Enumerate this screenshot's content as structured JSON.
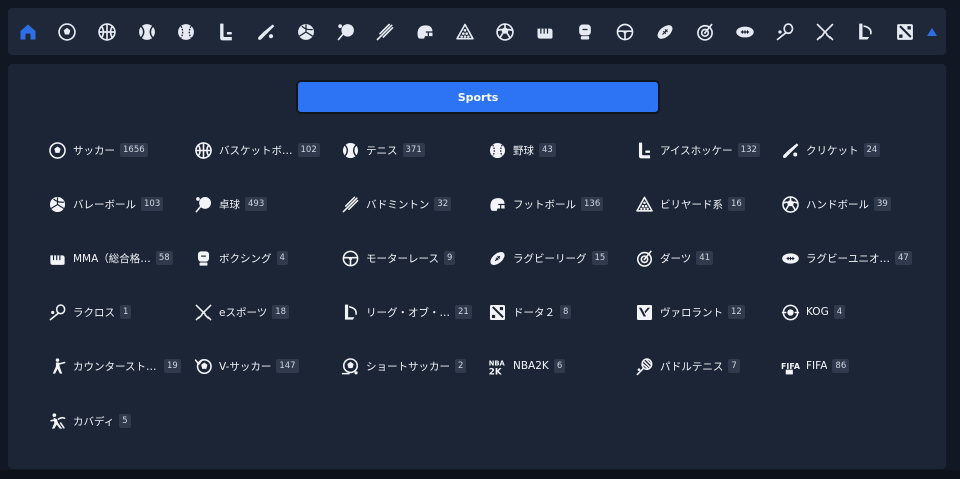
{
  "topbar": {
    "icons": [
      {
        "name": "home-icon",
        "active": true
      },
      {
        "name": "soccer-icon"
      },
      {
        "name": "basketball-icon"
      },
      {
        "name": "tennis-icon"
      },
      {
        "name": "baseball-icon"
      },
      {
        "name": "ice-hockey-icon"
      },
      {
        "name": "cricket-icon"
      },
      {
        "name": "volleyball-icon"
      },
      {
        "name": "table-tennis-icon"
      },
      {
        "name": "badminton-icon"
      },
      {
        "name": "american-football-helmet-icon"
      },
      {
        "name": "billiards-icon"
      },
      {
        "name": "handball-icon"
      },
      {
        "name": "mma-icon"
      },
      {
        "name": "boxing-icon"
      },
      {
        "name": "motor-racing-icon"
      },
      {
        "name": "rugby-league-icon"
      },
      {
        "name": "darts-icon"
      },
      {
        "name": "rugby-union-icon"
      },
      {
        "name": "lacrosse-icon"
      },
      {
        "name": "esports-icon"
      },
      {
        "name": "league-of-legends-icon"
      },
      {
        "name": "dota2-icon"
      }
    ],
    "collapse_icon": "caret-up-icon",
    "accent_color": "#2f6fe6"
  },
  "panel": {
    "tab_label": "Sports",
    "sports": [
      {
        "icon": "soccer-icon",
        "label": "サッカー",
        "count": "1656"
      },
      {
        "icon": "basketball-icon",
        "label": "バスケットボ…",
        "count": "102"
      },
      {
        "icon": "tennis-icon",
        "label": "テニス",
        "count": "371"
      },
      {
        "icon": "baseball-icon",
        "label": "野球",
        "count": "43"
      },
      {
        "icon": "ice-hockey-icon",
        "label": "アイスホッケー",
        "count": "132"
      },
      {
        "icon": "cricket-icon",
        "label": "クリケット",
        "count": "24"
      },
      {
        "icon": "volleyball-icon",
        "label": "バレーボール",
        "count": "103"
      },
      {
        "icon": "table-tennis-icon",
        "label": "卓球",
        "count": "493"
      },
      {
        "icon": "badminton-icon",
        "label": "バドミントン",
        "count": "32"
      },
      {
        "icon": "american-football-helmet-icon",
        "label": "フットボール",
        "count": "136"
      },
      {
        "icon": "billiards-icon",
        "label": "ビリヤード系",
        "count": "16"
      },
      {
        "icon": "handball-icon",
        "label": "ハンドボール",
        "count": "39"
      },
      {
        "icon": "mma-icon",
        "label": "MMA（総合格…",
        "count": "58"
      },
      {
        "icon": "boxing-icon",
        "label": "ボクシング",
        "count": "4"
      },
      {
        "icon": "motor-racing-icon",
        "label": "モーターレース",
        "count": "9"
      },
      {
        "icon": "rugby-league-icon",
        "label": "ラグビーリーグ",
        "count": "15"
      },
      {
        "icon": "darts-icon",
        "label": "ダーツ",
        "count": "41"
      },
      {
        "icon": "rugby-union-icon",
        "label": "ラグビーユニオ…",
        "count": "47"
      },
      {
        "icon": "lacrosse-icon",
        "label": "ラクロス",
        "count": "1"
      },
      {
        "icon": "esports-icon",
        "label": "eスポーツ",
        "count": "18"
      },
      {
        "icon": "league-of-legends-icon",
        "label": "リーグ・オブ・…",
        "count": "21"
      },
      {
        "icon": "dota2-icon",
        "label": "ドータ２",
        "count": "8"
      },
      {
        "icon": "valorant-icon",
        "label": "ヴァロラント",
        "count": "12"
      },
      {
        "icon": "kog-icon",
        "label": "KOG",
        "count": "4"
      },
      {
        "icon": "counter-strike-icon",
        "label": "カウンターストˇ…",
        "count": "19"
      },
      {
        "icon": "virtual-soccer-icon",
        "label": "V-サッカー",
        "count": "147"
      },
      {
        "icon": "short-soccer-icon",
        "label": "ショートサッカー",
        "count": "2"
      },
      {
        "icon": "nba2k-icon",
        "label": "NBA2K",
        "count": "6"
      },
      {
        "icon": "paddle-tennis-icon",
        "label": "パドルテニス",
        "count": "7"
      },
      {
        "icon": "fifa-icon",
        "label": "FIFA",
        "count": "86"
      },
      {
        "icon": "kabaddi-icon",
        "label": "カバディ",
        "count": "5"
      }
    ]
  }
}
